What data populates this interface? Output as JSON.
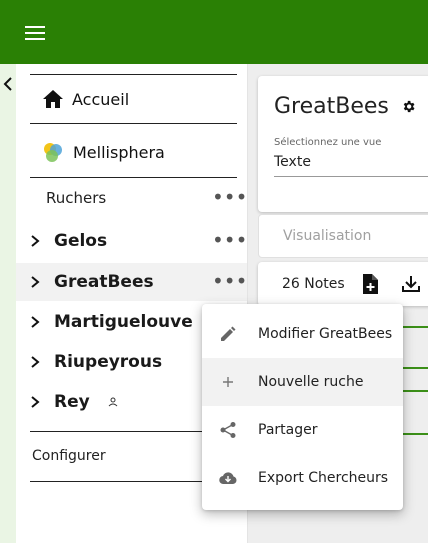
{
  "sidebar": {
    "home": "Accueil",
    "mellisphera": "Mellisphera",
    "apiaries_heading": "Ruchers",
    "hives": [
      {
        "label": "Gelos",
        "active": false
      },
      {
        "label": "GreatBees",
        "active": true
      },
      {
        "label": "Martiguelouve",
        "active": false
      },
      {
        "label": "Riupeyrous",
        "active": false
      },
      {
        "label": "Rey",
        "active": false
      }
    ],
    "configure": "Configurer"
  },
  "main": {
    "title": "GreatBees",
    "view_label": "Sélectionnez une vue",
    "view_value": "Texte",
    "visualisation": "Visualisation",
    "notes": "26 Notes"
  },
  "menu": {
    "items": [
      {
        "label": "Modifier GreatBees",
        "icon": "edit-icon"
      },
      {
        "label": "Nouvelle ruche",
        "icon": "plus-icon"
      },
      {
        "label": "Partager",
        "icon": "share-icon"
      },
      {
        "label": "Export Chercheurs",
        "icon": "cloud-download-icon"
      }
    ]
  },
  "colors": {
    "topbar": "#2a8005",
    "rail": "#eaf5e4"
  }
}
